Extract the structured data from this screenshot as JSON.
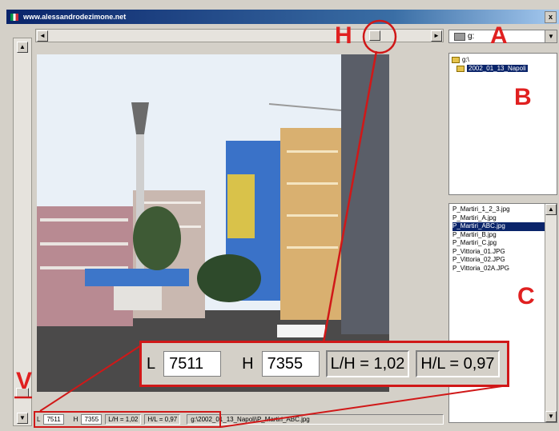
{
  "window": {
    "title": "www.alessandrodezimone.net",
    "close_label": "x"
  },
  "scroll": {
    "left_arrow": "◄",
    "right_arrow": "►",
    "up_arrow": "▲",
    "down_arrow": "▼"
  },
  "drive": {
    "value": "g:",
    "arrow": "▼"
  },
  "directories": [
    {
      "label": "g:\\",
      "selected": false
    },
    {
      "label": "2002_01_13_Napoli",
      "selected": true
    }
  ],
  "files": [
    {
      "label": "P_Martiri_1_2_3.jpg",
      "selected": false
    },
    {
      "label": "P_Martiri_A.jpg",
      "selected": false
    },
    {
      "label": "P_Martiri_ABC.jpg",
      "selected": true
    },
    {
      "label": "P_Martiri_B.jpg",
      "selected": false
    },
    {
      "label": "P_Martiri_C.jpg",
      "selected": false
    },
    {
      "label": "P_Vittoria_01.JPG",
      "selected": false
    },
    {
      "label": "P_Vittoria_02.JPG",
      "selected": false
    },
    {
      "label": "P_Vittoria_02A.JPG",
      "selected": false
    }
  ],
  "status": {
    "l_label": "L",
    "l_value": "7511",
    "h_label": "H",
    "h_value": "7355",
    "ratio_lh": "L/H = 1,02",
    "ratio_hl": "H/L = 0,97",
    "path": "g:\\2002_01_13_Napoli\\P_Martiri_ABC.jpg"
  },
  "callouts": {
    "a": "A",
    "b": "B",
    "c": "C",
    "h": "H",
    "v": "V"
  },
  "colors": {
    "annotation_red": "#d01818",
    "selection": "#0a246a"
  }
}
